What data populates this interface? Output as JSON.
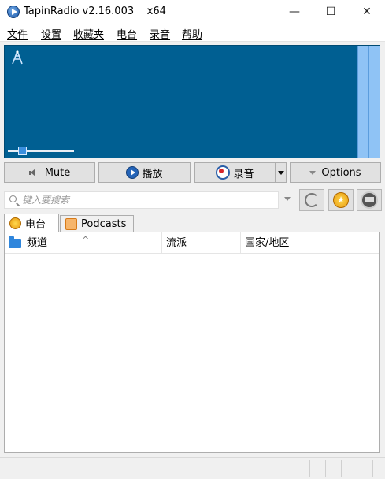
{
  "window": {
    "title": "TapinRadio v2.16.003    x64",
    "minimize": "—",
    "maximize": "☐",
    "close": "✕"
  },
  "menu": [
    "文件",
    "设置",
    "收藏夹",
    "电台",
    "录音",
    "帮助"
  ],
  "player": {
    "volume_level": 0.22
  },
  "controls": {
    "mute": "Mute",
    "play": "播放",
    "record": "录音",
    "options": "Options"
  },
  "search": {
    "placeholder": "键入要搜索"
  },
  "tabs": [
    "电台",
    "Podcasts"
  ],
  "columns": [
    "频道",
    "流派",
    "国家/地区"
  ],
  "icons": {
    "app": "tapinradio-play-icon",
    "mute": "speaker-icon",
    "play": "play-circle-icon",
    "record": "record-icon",
    "options": "chevron-down-icon",
    "search": "search-icon",
    "back": "back-arrow-icon",
    "favorites": "star-icon",
    "radio": "radio-icon",
    "stations_tab": "star-icon",
    "podcasts_tab": "rss-icon",
    "column_folder": "folder-icon"
  },
  "colors": {
    "visual_bg": "#005f92",
    "vu_meter": "#8fc3f5",
    "folder": "#2f86dc"
  }
}
